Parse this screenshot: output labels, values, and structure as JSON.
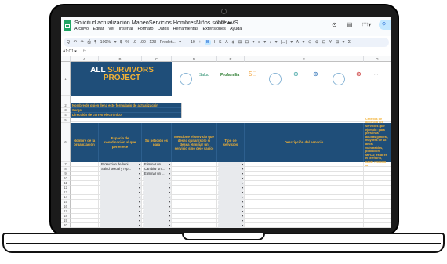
{
  "document": {
    "title": "Solicitud actualización MapeoServicios HombresNiños sobrev VS",
    "title_icons": "☆  ⊡  ☁"
  },
  "menu": [
    "Archivo",
    "Editar",
    "Ver",
    "Insertar",
    "Formato",
    "Datos",
    "Herramientas",
    "Extensiones",
    "Ayuda"
  ],
  "toolbar": {
    "items": [
      "Q",
      "↶",
      "↷",
      "⎙",
      "¶",
      "100%",
      "▾",
      "$",
      "%",
      ".0",
      ".00",
      "123",
      "Predet...",
      "▾",
      "−",
      "10",
      "+",
      "B",
      "I",
      "S",
      "A",
      "◈",
      "⊞",
      "⊟",
      "▾",
      "≡",
      "▾",
      "↓",
      "▾",
      "|↔|",
      "▾",
      "A",
      "▾",
      "⊝",
      "⊕",
      "⊡",
      "Y",
      "⊞",
      "▾",
      "Σ"
    ],
    "highlighted": "B"
  },
  "formula_bar": {
    "name_box": "A1:C1",
    "name_box_arrow": "▾",
    "fx": "fx"
  },
  "columns": [
    "A",
    "B",
    "C",
    "D",
    "E",
    "F",
    "G"
  ],
  "rows": [
    "1",
    "2",
    "3",
    "4",
    "5",
    "6",
    "7",
    "8",
    "9",
    "10",
    "11",
    "12",
    "13",
    "14",
    "15",
    "16",
    "17",
    "18",
    "19",
    "20"
  ],
  "banner": {
    "line1_white": "ALL ",
    "line1_yellow": "SURVIVORS",
    "line2": "PROJECT"
  },
  "logos": [
    "Salud",
    "Profamilia",
    "5⃝",
    "⊛",
    "⊛",
    "⊛",
    "···"
  ],
  "info_rows": [
    "Nombre de quién llena este formulario de actualización",
    "Cargo",
    "Dirección de correo electrónico"
  ],
  "table_headers": [
    "Nombre de la organización",
    "Espacio de coordinación al que pertenece",
    "Su petición es para",
    "Mencione el servicio que desea quitar (solo si desea eliminar un servicio sino deje vacío)",
    "Tipo de servicios",
    "Descripción del servicio",
    "Criterios de acceso a los servicios (por ejemplo: para personas adultas general, mayores de 18 años, vulnerables, población MPCA; estar en el territorio, haber recibido la..."
  ],
  "dropdown_rows": [
    {
      "b": "Protección de la ni...",
      "c": "Eliminar un ..."
    },
    {
      "b": "Salud sexual y rep...",
      "c": "Cambiar un ..."
    },
    {
      "b": "",
      "c": "Eliminar un ..."
    }
  ],
  "dropdown_arrow": "▾",
  "window_icons": [
    "⊙",
    "▤",
    "⬚▾"
  ],
  "share": "⊙"
}
